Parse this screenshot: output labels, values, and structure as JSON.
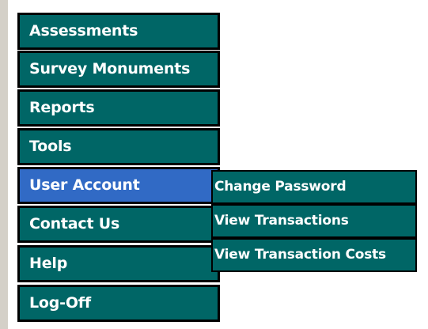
{
  "menu": {
    "items": [
      {
        "label": "Assessments"
      },
      {
        "label": "Survey Monuments"
      },
      {
        "label": "Reports"
      },
      {
        "label": "Tools"
      },
      {
        "label": "User Account"
      },
      {
        "label": "Contact Us"
      },
      {
        "label": "Help"
      },
      {
        "label": "Log-Off"
      }
    ],
    "active_index": 4
  },
  "submenu": {
    "items": [
      {
        "label": "Change Password"
      },
      {
        "label": "View Transactions"
      },
      {
        "label": "View Transaction Costs"
      }
    ]
  },
  "colors": {
    "item_background": "#006666",
    "active_background": "#316ac5",
    "border": "#000000",
    "text": "#ffffff"
  }
}
